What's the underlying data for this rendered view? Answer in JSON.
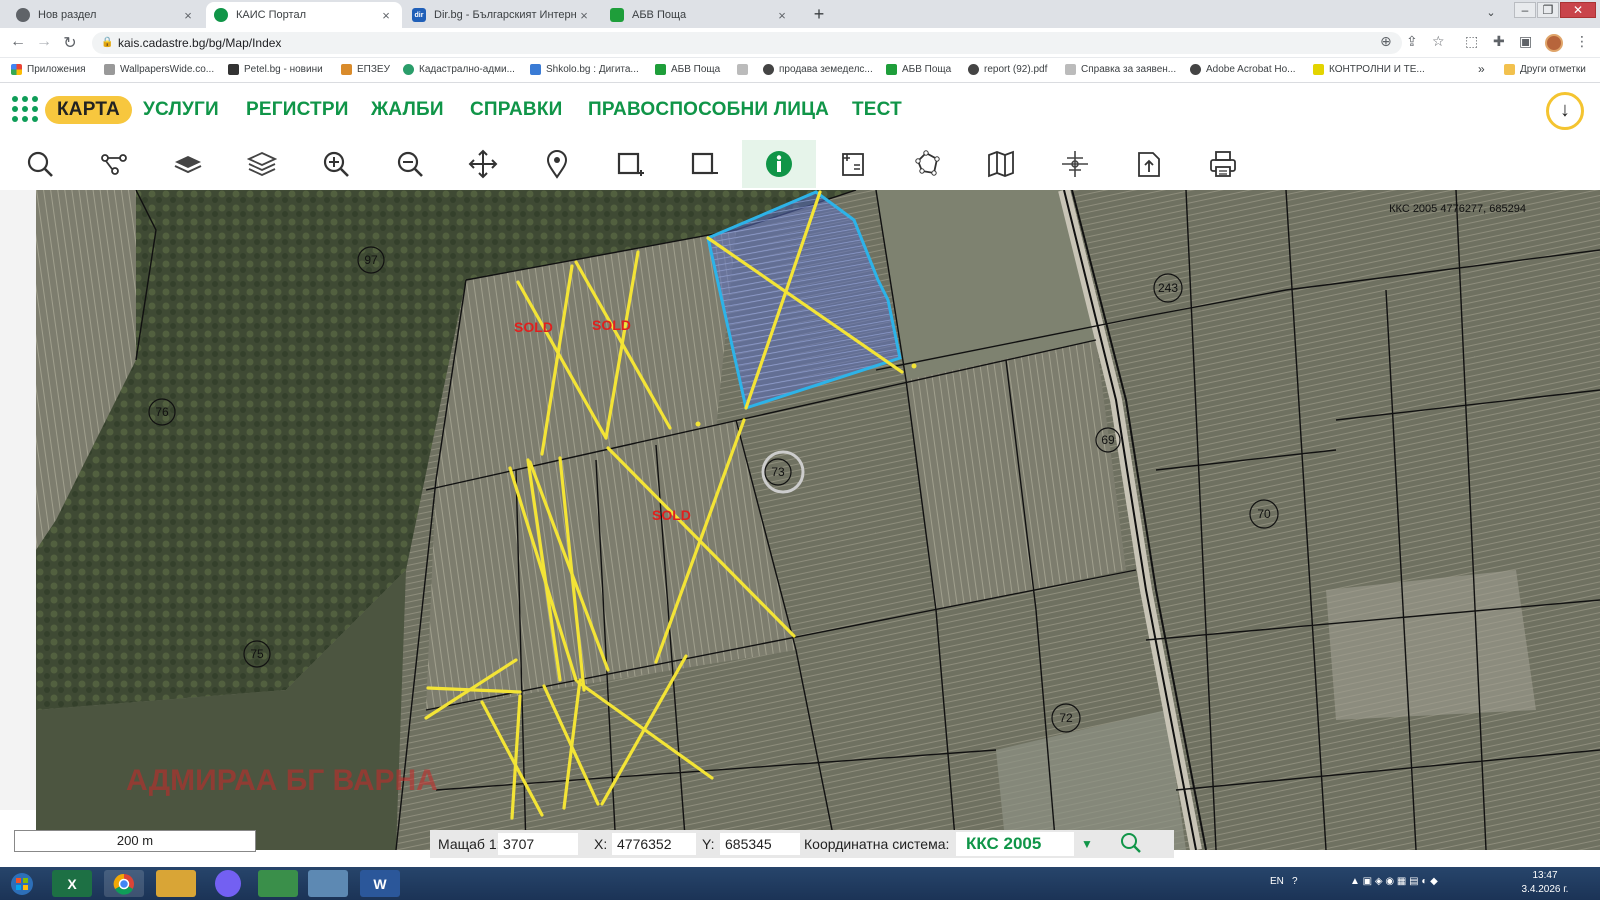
{
  "browser": {
    "tabs": [
      {
        "title": "Нов раздел",
        "close": "×",
        "favicon_color": "#5f6368"
      },
      {
        "title": "КАИС Портал",
        "close": "×",
        "favicon_color": "#109548",
        "active": true
      },
      {
        "title": "Dir.bg - Българският Интернет п",
        "close": "×",
        "favicon_color": "#1f5fb8",
        "favicon_text": "dir"
      },
      {
        "title": "АБВ Поща",
        "close": "×",
        "favicon_color": "#1e9e3a"
      }
    ],
    "new_tab": "+",
    "url": "kais.cadastre.bg/bg/Map/Index",
    "bookmarks": [
      "Приложения",
      "WallpapersWide.co...",
      "Petel.bg - новини",
      "ЕПЗЕУ",
      "Кадастрално-адми...",
      "Shkolo.bg : Дигита...",
      "АБВ Поща",
      "",
      "продава земеделс...",
      "АБВ Поща",
      "report (92).pdf",
      "Справка за заявен...",
      "Adobe Acrobat Ho...",
      "КОНТРОЛНИ И ТЕ..."
    ],
    "bookmarks_more": "»",
    "other_bookmarks": "Други отметки"
  },
  "nav": {
    "items": [
      "КАРТА",
      "УСЛУГИ",
      "РЕГИСТРИ",
      "ЖАЛБИ",
      "СПРАВКИ",
      "ПРАВОСПОСОБНИ ЛИЦА",
      "ТЕСТ"
    ],
    "active_index": 0,
    "download_icon": "↓"
  },
  "toolbar": {
    "tools": [
      "search-icon",
      "route-icon",
      "layer-icon",
      "layers-icon",
      "zoom-in-icon",
      "zoom-out-icon",
      "pan-icon",
      "marker-icon",
      "select-add-icon",
      "select-remove-icon",
      "info-icon",
      "measure-area-icon",
      "polygon-icon",
      "map-icon",
      "coordinates-icon",
      "export-icon",
      "print-icon"
    ],
    "active_index": 10
  },
  "map": {
    "coords_readout": "ККС 2005 4776277, 685294",
    "region_labels": [
      "97",
      "76",
      "75",
      "73",
      "243",
      "69",
      "70",
      "72"
    ],
    "sold_labels": [
      "SOLD",
      "SOLD",
      "SOLD"
    ],
    "watermark": "АДМИРАА БГ ВАРНА",
    "colors": {
      "selection": "#2db3e8",
      "marks": "#f3e436",
      "sold": "#e0201e"
    }
  },
  "status": {
    "scale_bar": "200 m",
    "scale_label": "Мащаб 1:",
    "scale_value": "3707",
    "x_label": "X:",
    "x_value": "4776352",
    "y_label": "Y:",
    "y_value": "685345",
    "crs_label": "Координатна система:",
    "crs_value": "ККС 2005",
    "crs_dropdown": "▼"
  },
  "taskbar": {
    "lang": "EN",
    "time": "13:47",
    "date": "3.4.2026 г."
  }
}
